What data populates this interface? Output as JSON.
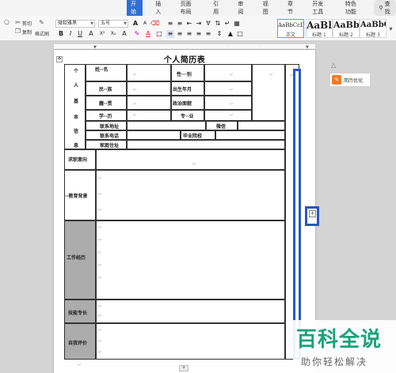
{
  "menu": {
    "tabs": [
      {
        "label": "开始",
        "active": true
      },
      {
        "label": "插入"
      },
      {
        "label": "页面布局"
      },
      {
        "label": "引用"
      },
      {
        "label": "审阅"
      },
      {
        "label": "视图"
      },
      {
        "label": "章节"
      },
      {
        "label": "开发工具"
      },
      {
        "label": "特色功能"
      }
    ],
    "search_label": "查找"
  },
  "ribbon": {
    "cut": "剪切",
    "copy": "复制",
    "format_painter": "格式刷",
    "font_name": "微软雅黑",
    "font_size": "五号",
    "styles": [
      {
        "sample": "AaBbCcDd",
        "label": "正文"
      },
      {
        "sample": "AaBl",
        "label": "标题 1"
      },
      {
        "sample": "AaBb(",
        "label": "标题 2"
      },
      {
        "sample": "AaBbC",
        "label": "标题 3"
      }
    ]
  },
  "document": {
    "title": "个人简历表",
    "basic_info_vertical": [
      "个",
      "人",
      "基",
      "本",
      "信",
      "息"
    ],
    "fields": {
      "name": "姓··名",
      "gender": "性···别",
      "ethnicity": "民··族",
      "birth": "出生年月",
      "origin": "籍··贯",
      "politics": "政治面貌",
      "education": "学··历",
      "major": "专··业",
      "address": "联系地址",
      "wechat": "微信",
      "phone": "联系电话",
      "school": "毕业院校",
      "home": "家庭住址"
    },
    "sections": {
      "intention": "求职意向",
      "edu_bg": "··教育背景",
      "work": "工作经历",
      "skills": "技能专长",
      "self_eval": "自我评价"
    },
    "para_mark": "↵"
  },
  "side_panel": {
    "label": "简历优化"
  },
  "watermark": {
    "title": "百科全说",
    "subtitle": "助你轻松解决"
  }
}
